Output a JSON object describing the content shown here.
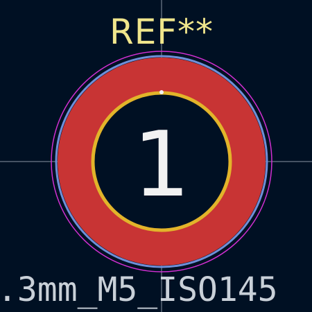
{
  "reference_label": "REF**",
  "pad": {
    "number": "1"
  },
  "footprint_value": ".3mm_M5_ISO145",
  "colors": {
    "background": "#001023",
    "crosshair": "#8a94a3",
    "courtyard": "#d22fd2",
    "fab_outline": "#6f8fd8",
    "copper": "#c83434",
    "silk_ring": "#e2b42a",
    "reference_text": "#f0e68c",
    "pad_number_text": "#f2f2f2",
    "value_text": "#c9d0d8"
  }
}
